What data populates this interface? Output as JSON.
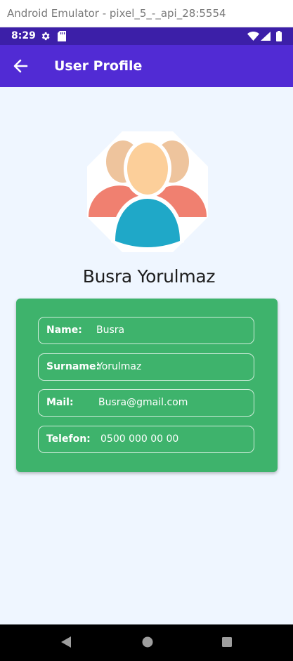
{
  "window": {
    "title": "Android Emulator - pixel_5_-_api_28:5554"
  },
  "status_bar": {
    "time": "8:29",
    "icons": [
      "gear-icon",
      "sd-card-icon",
      "wifi-icon",
      "signal-icon",
      "battery-icon"
    ]
  },
  "app_bar": {
    "back_icon": "arrow-left-icon",
    "title": "User Profile"
  },
  "profile": {
    "avatar_icon": "users-group-icon",
    "name": "Busra Yorulmaz"
  },
  "fields": [
    {
      "label": "Name:",
      "value": "Busra"
    },
    {
      "label": "Surname:",
      "value": "Yorulmaz"
    },
    {
      "label": "Mail:",
      "value": "Busra@gmail.com"
    },
    {
      "label": "Telefon:",
      "value": "0500 000 00 00"
    }
  ],
  "nav_bar": {
    "icons": [
      "back-triangle-icon",
      "home-circle-icon",
      "recents-square-icon"
    ]
  },
  "colors": {
    "status_bar": "#3c1fa8",
    "app_bar": "#512bd4",
    "background": "#eff6ff",
    "card": "#3eb36c"
  }
}
